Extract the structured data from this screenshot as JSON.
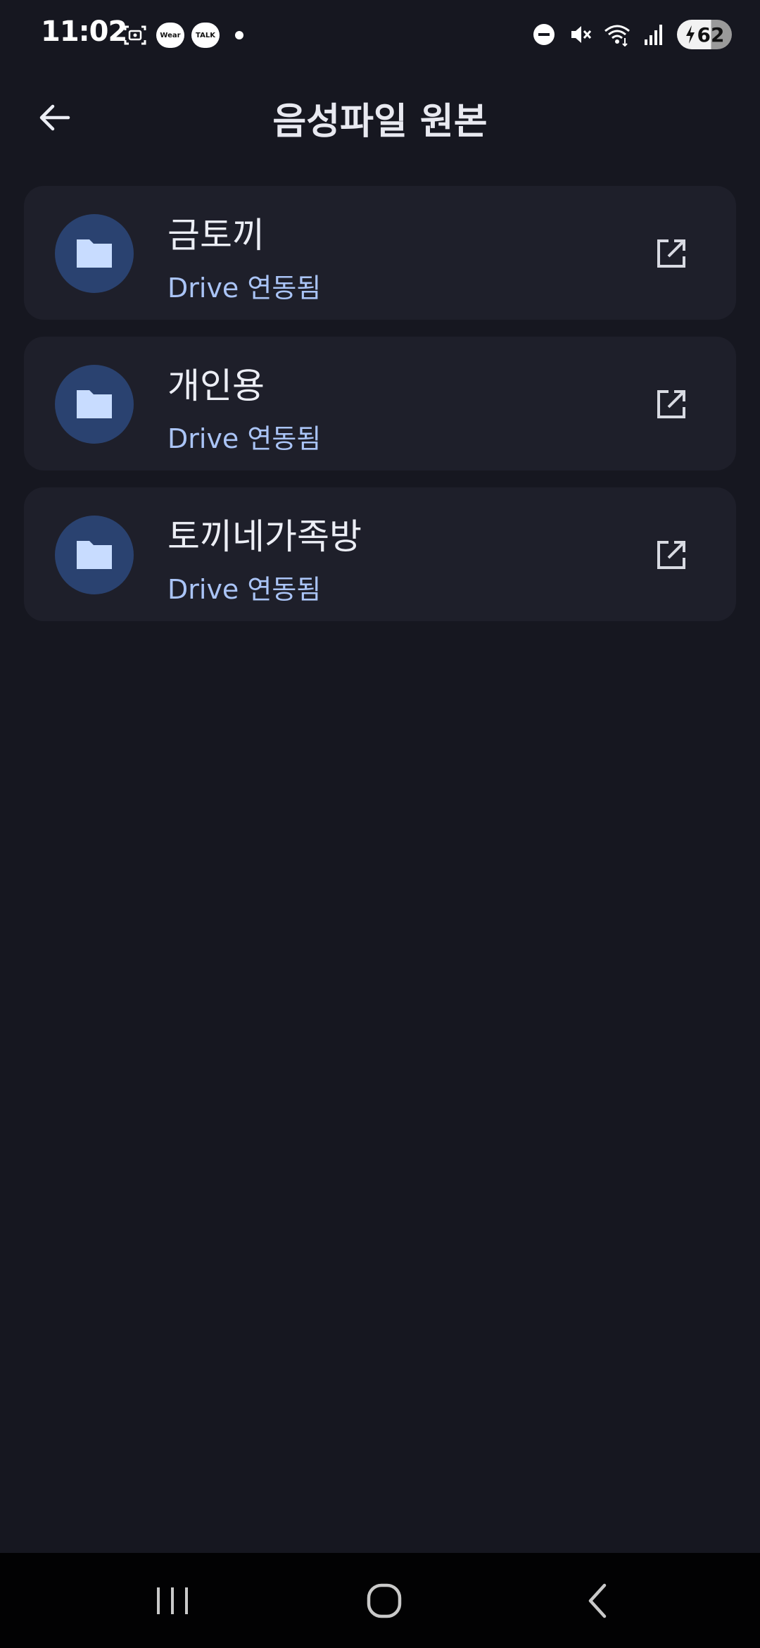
{
  "status_bar": {
    "time": "11:02",
    "wear_badge": "Wear",
    "talk_badge": "TALK",
    "battery_level": "62",
    "battery_percent": 62,
    "icons": [
      "screenshot-icon",
      "wear-icon",
      "talk-icon",
      "dnd-icon",
      "mute-icon",
      "wifi-icon",
      "signal-icon",
      "charging-icon"
    ]
  },
  "header": {
    "title": "음성파일 원본",
    "back_icon": "arrow-left-icon"
  },
  "folders": [
    {
      "name": "금토끼",
      "status": "Drive 연동됨"
    },
    {
      "name": "개인용",
      "status": "Drive 연동됨"
    },
    {
      "name": "토끼네가족방",
      "status": "Drive 연동됨"
    }
  ],
  "colors": {
    "background": "#161720",
    "card": "#1e1f2a",
    "avatar": "#2a4270",
    "accent": "#aac4f6",
    "nav_bar": "#020203"
  },
  "nav": {
    "icons": [
      "recent-apps-icon",
      "home-icon",
      "back-icon"
    ]
  }
}
